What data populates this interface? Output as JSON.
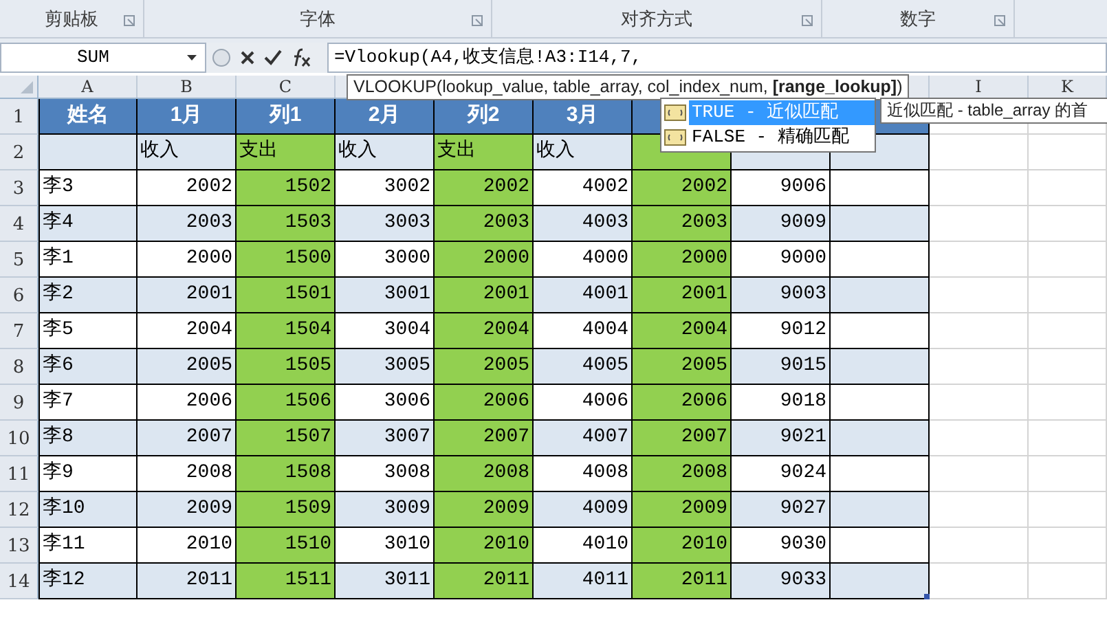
{
  "ribbon_groups": [
    {
      "label": "剪贴板"
    },
    {
      "label": "字体"
    },
    {
      "label": "对齐方式"
    },
    {
      "label": "数字"
    }
  ],
  "name_box": "SUM",
  "formula": "=Vlookup(A4,收支信息!A3:I14,7,",
  "column_headers_left": [
    "A",
    "B",
    "C"
  ],
  "column_headers_right": [
    "I",
    "K"
  ],
  "table_columns": [
    {
      "highlighted": false
    },
    {
      "highlighted": false
    },
    {
      "highlighted": true
    },
    {
      "highlighted": false
    },
    {
      "highlighted": true
    },
    {
      "highlighted": false
    },
    {
      "highlighted": true
    },
    {
      "highlighted": false
    },
    {
      "highlighted": false
    }
  ],
  "header_row": {
    "number": "1",
    "cells": [
      "姓名",
      "1月",
      "列1",
      "2月",
      "列2",
      "3月"
    ]
  },
  "rows": [
    {
      "number": "2",
      "kind": "subheader",
      "banded": true,
      "cells": [
        null,
        "收入",
        "支出",
        "收入",
        "支出",
        "收入",
        null,
        null,
        null
      ]
    },
    {
      "number": "3",
      "kind": "data",
      "banded": false,
      "cells": [
        "李3",
        "2002",
        "1502",
        "3002",
        "2002",
        "4002",
        "2002",
        "9006",
        null
      ]
    },
    {
      "number": "4",
      "kind": "data",
      "banded": true,
      "cells": [
        "李4",
        "2003",
        "1503",
        "3003",
        "2003",
        "4003",
        "2003",
        "9009",
        null
      ]
    },
    {
      "number": "5",
      "kind": "data",
      "banded": false,
      "cells": [
        "李1",
        "2000",
        "1500",
        "3000",
        "2000",
        "4000",
        "2000",
        "9000",
        null
      ]
    },
    {
      "number": "6",
      "kind": "data",
      "banded": true,
      "cells": [
        "李2",
        "2001",
        "1501",
        "3001",
        "2001",
        "4001",
        "2001",
        "9003",
        null
      ]
    },
    {
      "number": "7",
      "kind": "data",
      "banded": false,
      "cells": [
        "李5",
        "2004",
        "1504",
        "3004",
        "2004",
        "4004",
        "2004",
        "9012",
        null
      ]
    },
    {
      "number": "8",
      "kind": "data",
      "banded": true,
      "cells": [
        "李6",
        "2005",
        "1505",
        "3005",
        "2005",
        "4005",
        "2005",
        "9015",
        null
      ]
    },
    {
      "number": "9",
      "kind": "data",
      "banded": false,
      "cells": [
        "李7",
        "2006",
        "1506",
        "3006",
        "2006",
        "4006",
        "2006",
        "9018",
        null
      ]
    },
    {
      "number": "10",
      "kind": "data",
      "banded": true,
      "cells": [
        "李8",
        "2007",
        "1507",
        "3007",
        "2007",
        "4007",
        "2007",
        "9021",
        null
      ]
    },
    {
      "number": "11",
      "kind": "data",
      "banded": false,
      "cells": [
        "李9",
        "2008",
        "1508",
        "3008",
        "2008",
        "4008",
        "2008",
        "9024",
        null
      ]
    },
    {
      "number": "12",
      "kind": "data",
      "banded": true,
      "cells": [
        "李10",
        "2009",
        "1509",
        "3009",
        "2009",
        "4009",
        "2009",
        "9027",
        null
      ]
    },
    {
      "number": "13",
      "kind": "data",
      "banded": false,
      "cells": [
        "李11",
        "2010",
        "1510",
        "3010",
        "2010",
        "4010",
        "2010",
        "9030",
        null
      ]
    },
    {
      "number": "14",
      "kind": "data",
      "banded": true,
      "cells": [
        "李12",
        "2011",
        "1511",
        "3011",
        "2011",
        "4011",
        "2011",
        "9033",
        null
      ]
    }
  ],
  "function_tooltip": "VLOOKUP(lookup_value, table_array, col_index_num, **[range_lookup]**)",
  "autocomplete": [
    {
      "label": "TRUE - 近似匹配",
      "selected": true
    },
    {
      "label": "FALSE - 精确匹配",
      "selected": false
    }
  ],
  "option_tooltip": "近似匹配 - table_array 的首"
}
